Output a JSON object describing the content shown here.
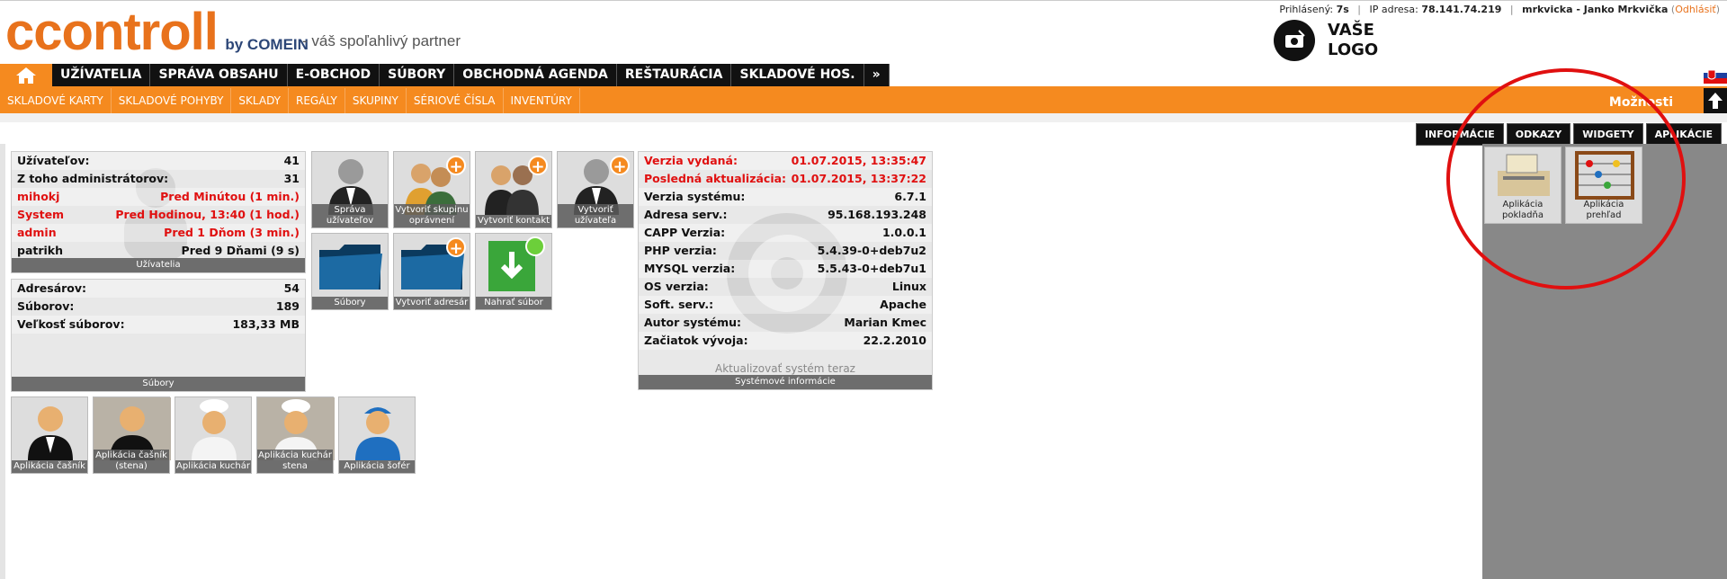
{
  "header": {
    "logo_text": "ccontroll",
    "logo_by": "by COMEIN",
    "tagline": "- váš spoľahlivý partner",
    "your_logo": "VAŠE LOGO",
    "status": {
      "logged_label": "Prihlásený:",
      "logged_value": "7s",
      "ip_label": "IP adresa:",
      "ip_value": "78.141.74.219",
      "user": "mrkvicka - Janko Mrkvička",
      "logout": "Odhlásiť"
    }
  },
  "mainnav": {
    "home_icon": "home-icon",
    "items": [
      "UŽÍVATELIA",
      "SPRÁVA OBSAHU",
      "E-OBCHOD",
      "SÚBORY",
      "OBCHODNÁ AGENDA",
      "REŠTAURÁCIA",
      "SKLADOVÉ HOS.",
      "»"
    ]
  },
  "subnav": {
    "items": [
      "SKLADOVÉ KARTY",
      "SKLADOVÉ POHYBY",
      "SKLADY",
      "REGÁLY",
      "SKUPINY",
      "SÉRIOVÉ ČÍSLA",
      "INVENTÚRY"
    ],
    "options": "Možnosti"
  },
  "tabs": [
    "INFORMÁCIE",
    "ODKAZY",
    "WIDGETY",
    "APLIKÁCIE"
  ],
  "users_widget": {
    "rows": [
      {
        "k": "Užívateľov:",
        "v": "41",
        "red": false
      },
      {
        "k": "Z toho administrátorov:",
        "v": "31",
        "red": false
      },
      {
        "k": "mihokj",
        "v": "Pred Minútou (1 min.)",
        "red": true
      },
      {
        "k": "System",
        "v": "Pred Hodinou, 13:40 (1 hod.)",
        "red": true
      },
      {
        "k": "admin",
        "v": "Pred 1 Dňom (3 min.)",
        "red": true
      },
      {
        "k": "patrikh",
        "v": "Pred 9 Dňami (9 s)",
        "red": false
      }
    ],
    "footer": "Užívatelia"
  },
  "files_widget": {
    "rows": [
      {
        "k": "Adresárov:",
        "v": "54"
      },
      {
        "k": "Súborov:",
        "v": "189"
      },
      {
        "k": "Veľkosť súborov:",
        "v": "183,33 MB"
      }
    ],
    "footer": "Súbory"
  },
  "system_widget": {
    "rows": [
      {
        "k": "Verzia vydaná:",
        "v": "01.07.2015, 13:35:47",
        "red": true
      },
      {
        "k": "Posledná aktualizácia:",
        "v": "01.07.2015, 13:37:22",
        "red": true
      },
      {
        "k": "Verzia systému:",
        "v": "6.7.1",
        "red": false
      },
      {
        "k": "Adresa serv.:",
        "v": "95.168.193.248",
        "red": false
      },
      {
        "k": "CAPP Verzia:",
        "v": "1.0.0.1",
        "red": false
      },
      {
        "k": "PHP verzia:",
        "v": "5.4.39-0+deb7u2",
        "red": false
      },
      {
        "k": "MYSQL verzia:",
        "v": "5.5.43-0+deb7u1",
        "red": false
      },
      {
        "k": "OS verzia:",
        "v": "Linux",
        "red": false
      },
      {
        "k": "Soft. serv.:",
        "v": "Apache",
        "red": false
      },
      {
        "k": "Autor systému:",
        "v": "Marian Kmec",
        "red": false
      },
      {
        "k": "Začiatok vývoja:",
        "v": "22.2.2010",
        "red": false
      }
    ],
    "update": "Aktualizovať systém teraz",
    "footer": "Systémové informácie"
  },
  "tiles_top": [
    "Správa užívateľov",
    "Vytvoriť skupinu oprávnení",
    "Vytvoriť kontakt",
    "Vytvoriť užívateľa"
  ],
  "tiles_mid": [
    "Súbory",
    "Vytvoriť adresár",
    "Nahrať súbor"
  ],
  "tiles_bottom": [
    "Aplikácia čašník",
    "Aplikácia čašník (stena)",
    "Aplikácia kuchár",
    "Aplikácia kuchár stena",
    "Aplikácia šofér"
  ],
  "apps": [
    "Aplikácia pokladňa",
    "Aplikácia prehľad"
  ],
  "colors": {
    "accent": "#f58a1f",
    "nav": "#111111",
    "highlight": "#e01010"
  }
}
